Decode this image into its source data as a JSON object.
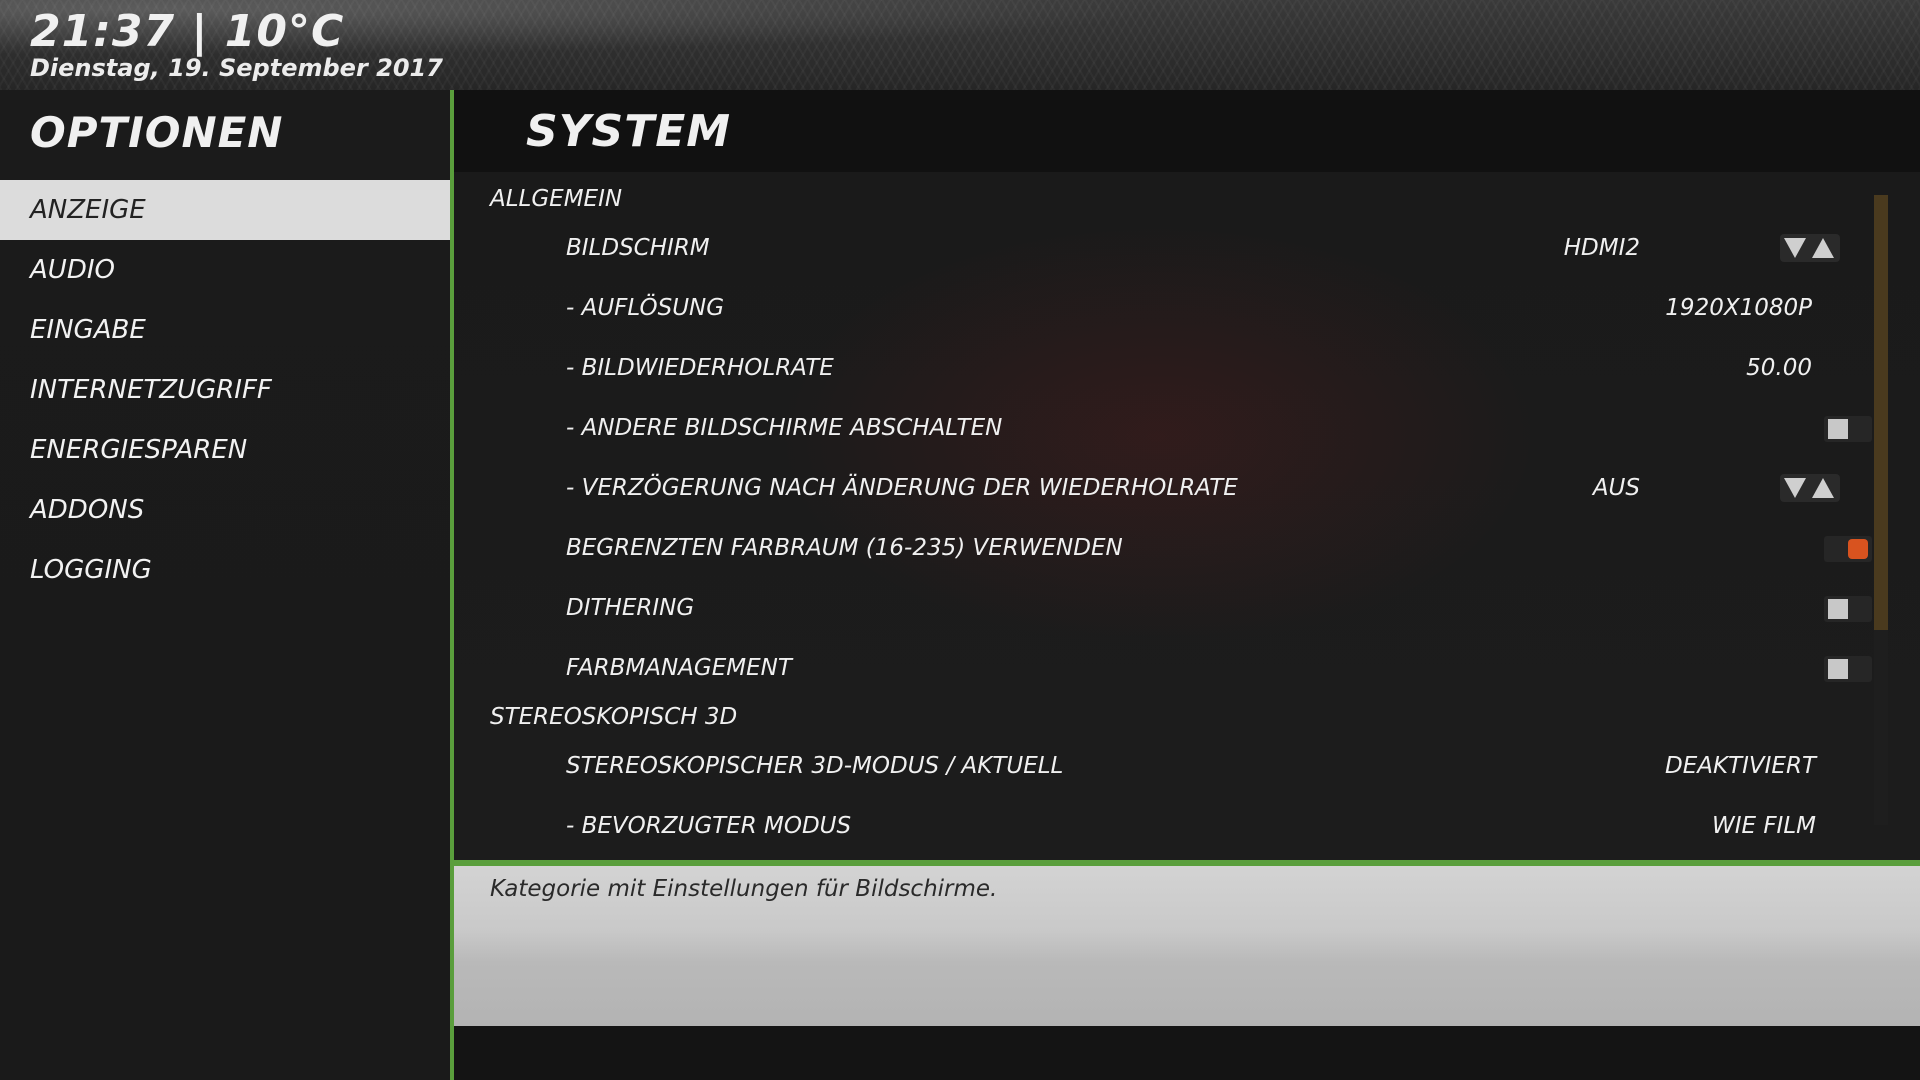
{
  "header": {
    "clock": "21:37 | 10°C",
    "date": "Dienstag, 19. September 2017"
  },
  "sidebar": {
    "title": "OPTIONEN",
    "items": [
      {
        "label": "ANZEIGE",
        "active": true
      },
      {
        "label": "AUDIO"
      },
      {
        "label": "EINGABE"
      },
      {
        "label": "INTERNETZUGRIFF"
      },
      {
        "label": "ENERGIESPAREN"
      },
      {
        "label": "ADDONS"
      },
      {
        "label": "LOGGING"
      }
    ]
  },
  "main": {
    "title": "SYSTEM",
    "sections": [
      {
        "label": "ALLGEMEIN",
        "rows": [
          {
            "label": "BILDSCHIRM",
            "value": "HDMI2",
            "control": "spinner"
          },
          {
            "label": "- AUFLÖSUNG",
            "value": "1920X1080P"
          },
          {
            "label": "- BILDWIEDERHOLRATE",
            "value": "50.00"
          },
          {
            "label": "- ANDERE BILDSCHIRME ABSCHALTEN",
            "control": "toggle",
            "on": false
          },
          {
            "label": "- VERZÖGERUNG NACH ÄNDERUNG DER WIEDERHOLRATE",
            "value": "AUS",
            "control": "spinner"
          },
          {
            "label": "BEGRENZTEN FARBRAUM (16-235) VERWENDEN",
            "control": "toggle",
            "on": true
          },
          {
            "label": "DITHERING",
            "control": "toggle",
            "on": false
          },
          {
            "label": "FARBMANAGEMENT",
            "control": "toggle",
            "on": false
          }
        ]
      },
      {
        "label": "STEREOSKOPISCH 3D",
        "rows": [
          {
            "label": "STEREOSKOPISCHER 3D-MODUS / AKTUELL",
            "value": "DEAKTIVIERT"
          },
          {
            "label": "- BEVORZUGTER MODUS",
            "value": "WIE FILM"
          }
        ]
      }
    ]
  },
  "description": "Kategorie mit Einstellungen für Bildschirme.",
  "colors": {
    "accent": "#5a9e3c",
    "toggle_on": "#d8531f",
    "selected_bg": "#dcdcdc"
  }
}
